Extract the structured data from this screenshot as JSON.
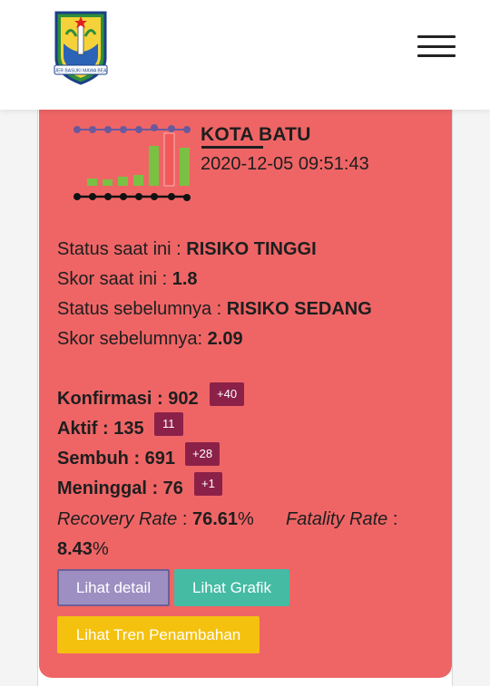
{
  "header": {
    "logo_icon": "east-java-province-emblem",
    "logo_motto": "JER BASUKI MAWA BEA",
    "menu_icon": "hamburger-menu-icon"
  },
  "card": {
    "city": "KOTA BATU",
    "timestamp": "2020-12-05 09:51:43",
    "status_now_label": "Status saat ini : ",
    "status_now_value": "RISIKO TINGGI",
    "score_now_label": "Skor saat ini : ",
    "score_now_value": "1.8",
    "status_prev_label": "Status sebelumnya : ",
    "status_prev_value": "RISIKO SEDANG",
    "score_prev_label": "Skor sebelumnya: ",
    "score_prev_value": "2.09",
    "confirmed_label": "Konfirmasi",
    "confirmed_value": " : 902",
    "confirmed_delta": "+40",
    "active_label": "Aktif",
    "active_value": " : 135",
    "active_delta": "11",
    "recovered_label": "Sembuh",
    "recovered_value": " : 691",
    "recovered_delta": "+28",
    "deaths_label": "Meninggal",
    "deaths_value": " : 76",
    "deaths_delta": "+1",
    "recovery_label": "Recovery Rate",
    "recovery_sep": " : ",
    "recovery_value": "76.61",
    "percent": "%",
    "fatality_label": "Fatality Rate",
    "fatality_sep": " :",
    "fatality_value": "8.43",
    "btn_detail": "Lihat detail",
    "btn_grafik": "Lihat Grafik",
    "btn_tren": "Lihat Tren Penambahan"
  },
  "colors": {
    "card_bg": "#ef6566",
    "badge_bg": "#8b2148",
    "btn_detail": "#9d8fc2",
    "btn_grafik": "#45bba4",
    "btn_tren": "#f4c10f",
    "bar_green": "#7ac143",
    "bar_red": "#ef6566",
    "dot_purple": "#8a79b8"
  }
}
